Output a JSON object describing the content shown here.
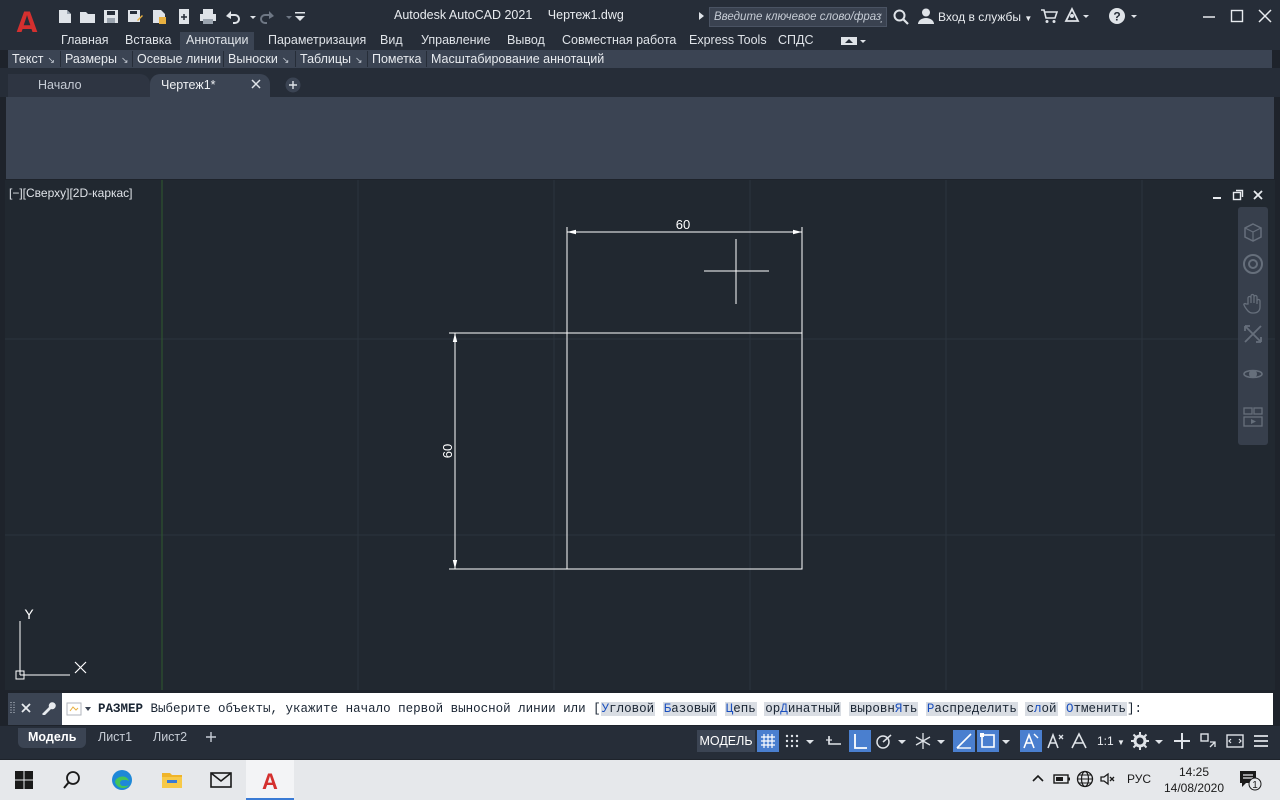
{
  "app": {
    "name": "Autodesk AutoCAD 2021",
    "file": "Чертеж1.dwg",
    "logo_letter": "A",
    "accent_color": "#d4302f"
  },
  "quick_access": [
    "new-icon",
    "open-icon",
    "save-icon",
    "save-as-icon",
    "publish-icon",
    "plot-icon",
    "print-icon",
    "undo-icon",
    "redo-icon",
    "customize-icon"
  ],
  "search": {
    "placeholder": "Введите ключевое слово/фразу"
  },
  "signin": {
    "label": "Вход в службы"
  },
  "ribbon_tabs": [
    {
      "label": "Главная"
    },
    {
      "label": "Вставка"
    },
    {
      "label": "Аннотации",
      "active": true
    },
    {
      "label": "Параметризация"
    },
    {
      "label": "Вид"
    },
    {
      "label": "Управление"
    },
    {
      "label": "Вывод"
    },
    {
      "label": "Совместная работа"
    },
    {
      "label": "Express Tools"
    },
    {
      "label": "СПДС"
    }
  ],
  "panels": [
    {
      "label": "Текст",
      "launcher": "↘"
    },
    {
      "label": "Размеры",
      "launcher": "↘"
    },
    {
      "label": "Осевые линии"
    },
    {
      "label": "Выноски",
      "launcher": "↘"
    },
    {
      "label": "Таблицы",
      "launcher": "↘"
    },
    {
      "label": "Пометка"
    },
    {
      "label": "Масштабирование аннотаций"
    }
  ],
  "file_tabs": [
    {
      "label": "Начало"
    },
    {
      "label": "Чертеж1*",
      "active": true
    }
  ],
  "viewport": {
    "label": "[−][Сверху][2D-каркас]"
  },
  "drawing": {
    "dim_horizontal": "60",
    "dim_vertical": "60",
    "line_color": "#ffffff",
    "grid_color": "#2c343e",
    "y_axis_color": "#2e5a2e"
  },
  "ucs": {
    "y_label": "Y"
  },
  "command_line": {
    "command": "РАЗМЕР",
    "prompt": "Выберите объекты, укажите начало первой выносной линии или",
    "options": [
      {
        "key": "У",
        "rest": "гловой"
      },
      {
        "key": "Б",
        "rest": "азовый"
      },
      {
        "key": "Ц",
        "rest": "епь"
      },
      {
        "key_pre": "ор",
        "key": "Д",
        "rest": "инатный"
      },
      {
        "key_pre": "выровн",
        "key": "Я",
        "rest": "ть"
      },
      {
        "key": "Р",
        "rest": "аспределить"
      },
      {
        "key_pre": "с",
        "key": "л",
        "rest": "ой"
      },
      {
        "key": "О",
        "rest": "тменить"
      }
    ]
  },
  "layout_tabs": [
    {
      "label": "Модель",
      "active": true
    },
    {
      "label": "Лист1"
    },
    {
      "label": "Лист2"
    }
  ],
  "status": {
    "model_label": "МОДЕЛЬ",
    "scale": "1:1"
  },
  "taskbar": {
    "lang": "РУС",
    "time": "14:25",
    "date": "14/08/2020",
    "notification_count": "1"
  }
}
